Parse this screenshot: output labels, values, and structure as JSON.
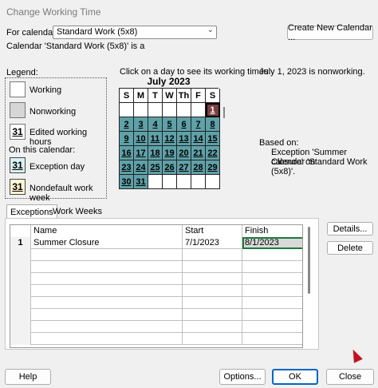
{
  "window": {
    "title": "Change Working Time"
  },
  "calendar_select": {
    "label": "For calendar:",
    "value": "Standard Work (5x8)",
    "create_button": "Create New Calendar ..."
  },
  "calendar_is": "Calendar 'Standard Work (5x8)' is a",
  "legend": {
    "title": "Legend:",
    "working": "Working",
    "nonworking": "Nonworking",
    "edited": "Edited working hours",
    "sample_number": "31",
    "on_this_calendar": "On this calendar:",
    "exception_day": "Exception day",
    "nondefault": "Nondefault work week"
  },
  "instructions": "Click on a day to see its working times:",
  "status": "July 1, 2023 is nonworking.",
  "based_on": {
    "label": "Based on:",
    "line1": "Exception 'Summer Closure' on",
    "line2": "calendar 'Standard Work (5x8)'."
  },
  "month": {
    "title": "July 2023",
    "weekdays": [
      "S",
      "M",
      "T",
      "W",
      "Th",
      "F",
      "S"
    ],
    "rows": [
      [
        "",
        "",
        "",
        "",
        "",
        "",
        "1"
      ],
      [
        "2",
        "3",
        "4",
        "5",
        "6",
        "7",
        "8"
      ],
      [
        "9",
        "10",
        "11",
        "12",
        "13",
        "14",
        "15"
      ],
      [
        "16",
        "17",
        "18",
        "19",
        "20",
        "21",
        "22"
      ],
      [
        "23",
        "24",
        "25",
        "26",
        "27",
        "28",
        "29"
      ],
      [
        "30",
        "31",
        "",
        "",
        "",
        "",
        ""
      ]
    ]
  },
  "tabs": {
    "exceptions": "Exceptions",
    "work_weeks": "Work Weeks"
  },
  "table": {
    "headers": {
      "name": "Name",
      "start": "Start",
      "finish": "Finish"
    },
    "rows": [
      {
        "num": "1",
        "name": "Summer Closure",
        "start": "7/1/2023",
        "finish": "8/1/2023"
      }
    ]
  },
  "side_buttons": {
    "details": "Details...",
    "delete": "Delete"
  },
  "footer": {
    "help": "Help",
    "options": "Options...",
    "ok": "OK",
    "close": "Close"
  }
}
